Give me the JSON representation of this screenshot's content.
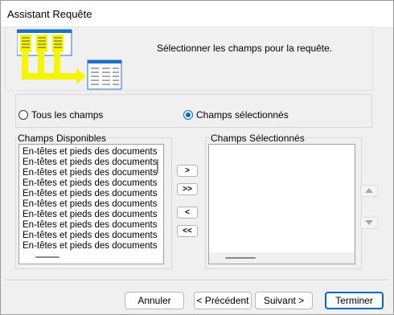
{
  "window": {
    "title": "Assistant Requête"
  },
  "header": {
    "instruction": "Sélectionner les champs pour la requête."
  },
  "options": {
    "all_fields": "Tous les champs",
    "selected_fields": "Champs sélectionnés",
    "selected": "selected_fields"
  },
  "available": {
    "label": "Champs Disponibles",
    "items": [
      "En-têtes et pieds des documents",
      "En-têtes et pieds des documents",
      "En-têtes et pieds des documents",
      "En-têtes et pieds des documents",
      "En-têtes et pieds des documents",
      "En-têtes et pieds des documents",
      "En-têtes et pieds des documents",
      "En-têtes et pieds des documents",
      "En-têtes et pieds des documents",
      "En-têtes et pieds des documents"
    ]
  },
  "selected_list": {
    "label": "Champs Sélectionnés",
    "items": []
  },
  "transfer": {
    "add": ">",
    "add_all": ">>",
    "remove": "<",
    "remove_all": "<<"
  },
  "footer": {
    "cancel": "Annuler",
    "previous": "< Précédent",
    "next": "Suivant >",
    "finish": "Terminer"
  },
  "colors": {
    "accent": "#0067c0",
    "wizard_yellow": "#f5f500",
    "wizard_blue": "#1f6fc4"
  }
}
